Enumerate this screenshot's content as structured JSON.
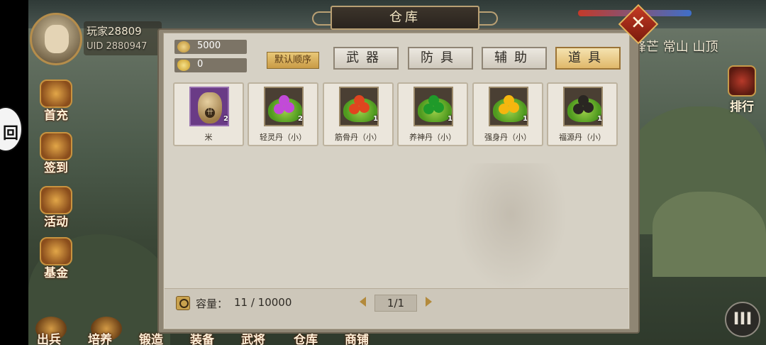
{
  "window": {
    "title": "仓库"
  },
  "player": {
    "name": "玩家28809",
    "uid": "UID 2880947"
  },
  "side_menu": [
    "首充",
    "签到",
    "活动",
    "基金"
  ],
  "bottom_nav": [
    "出兵",
    "培养",
    "锻造",
    "装备",
    "武将",
    "仓库",
    "商铺"
  ],
  "location": "锋芒 常山   山顶",
  "rank": {
    "label": "排行"
  },
  "side_circle": "回",
  "menu_button": "III",
  "close": "✕",
  "currency": {
    "coins": "5000",
    "ingots": "0"
  },
  "sort_label": "默认顺序",
  "tabs": [
    {
      "label": "武器",
      "active": false
    },
    {
      "label": "防具",
      "active": false
    },
    {
      "label": "辅助",
      "active": false
    },
    {
      "label": "道具",
      "active": true
    }
  ],
  "items": [
    {
      "name": "米",
      "count": "2",
      "icon": "rice-sack-icon"
    },
    {
      "name": "轻灵丹（小）",
      "count": "2",
      "icon": "pill-icon",
      "pill_color": "#c24ad8"
    },
    {
      "name": "筋骨丹（小）",
      "count": "1",
      "icon": "pill-icon",
      "pill_color": "#e0451f"
    },
    {
      "name": "养神丹（小）",
      "count": "1",
      "icon": "pill-icon",
      "pill_color": "#1f9a2a"
    },
    {
      "name": "强身丹（小）",
      "count": "1",
      "icon": "pill-icon",
      "pill_color": "#f5b60f"
    },
    {
      "name": "福源丹（小）",
      "count": "1",
      "icon": "pill-icon",
      "pill_color": "#2a2622"
    }
  ],
  "capacity": {
    "label": "容量：",
    "value": "11 / 10000"
  },
  "pagination": {
    "value": "1/1"
  }
}
